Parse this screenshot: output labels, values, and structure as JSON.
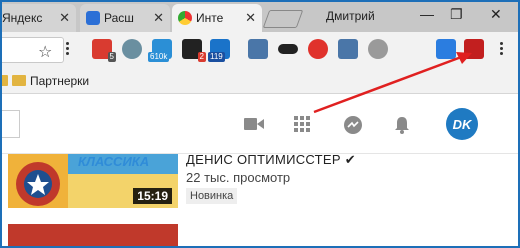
{
  "tabs": [
    {
      "label": "Яндекс",
      "close": "✕"
    },
    {
      "label": "Расш",
      "close": "✕"
    },
    {
      "label": "Инте",
      "close": "✕"
    }
  ],
  "window": {
    "user": "Дмитрий",
    "minimize": "—",
    "restore": "❐",
    "close": "✕"
  },
  "toolbar": {
    "star": "☆",
    "extensions": [
      {
        "name": "ext-1",
        "badge": "5",
        "color": "#d93b30",
        "badge_color": "#555555"
      },
      {
        "name": "ext-2",
        "badge": "",
        "color": "#6a8fa0",
        "badge_color": ""
      },
      {
        "name": "ext-3",
        "badge": "610k",
        "color": "#2b8fd6",
        "badge_color": "#2b8fd6"
      },
      {
        "name": "ext-4",
        "badge": "2",
        "color": "#222222",
        "badge_color": "#d93b30"
      },
      {
        "name": "ext-5",
        "badge": "119",
        "color": "#1a73c9",
        "badge_color": "#1a4fa0"
      },
      {
        "name": "vk-1",
        "badge": "",
        "color": "#4a76a8",
        "badge_color": ""
      },
      {
        "name": "mask",
        "badge": "",
        "color": "#222222",
        "badge_color": ""
      },
      {
        "name": "red-circle",
        "badge": "",
        "color": "#e0322c",
        "badge_color": ""
      },
      {
        "name": "vk-2",
        "badge": "",
        "color": "#4a76a8",
        "badge_color": ""
      },
      {
        "name": "vuejs",
        "badge": "",
        "color": "#9a9a9a",
        "badge_color": ""
      },
      {
        "name": "link",
        "badge": "",
        "color": "#2b7de0",
        "badge_color": ""
      },
      {
        "name": "pin",
        "badge": "",
        "color": "#c21f1f",
        "badge_color": ""
      }
    ]
  },
  "bookmarks": {
    "items": [
      {
        "label": "Партнерки"
      }
    ]
  },
  "youtube": {
    "avatar_text": "DK",
    "video": {
      "thumb_title": "КЛАССИКА",
      "duration": "15:19",
      "channel": "ДЕНИС ОПТИМИССТЕР ✔",
      "views": "22 тыс. просмотр",
      "badge": "Новинка"
    },
    "next_title": "— — —— — —— —— — ——"
  },
  "colors": {
    "accent": "#1d6fb8",
    "arrow": "#e02020"
  }
}
